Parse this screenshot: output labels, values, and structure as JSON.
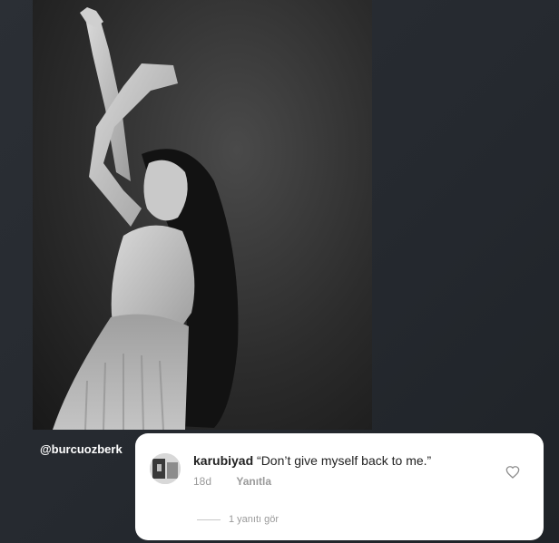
{
  "post": {
    "handle": "@burcuozberk"
  },
  "comment": {
    "username": "karubiyad",
    "text": "“Don’t give myself back to me.”",
    "time": "18d",
    "reply_label": "Yanıtla",
    "view_replies_label": "1 yanıtı gör"
  },
  "icons": {
    "like": "heart-icon",
    "avatar": "avatar"
  },
  "colors": {
    "background": "#272b31",
    "card": "#ffffff",
    "muted_text": "#9a9a9a"
  }
}
